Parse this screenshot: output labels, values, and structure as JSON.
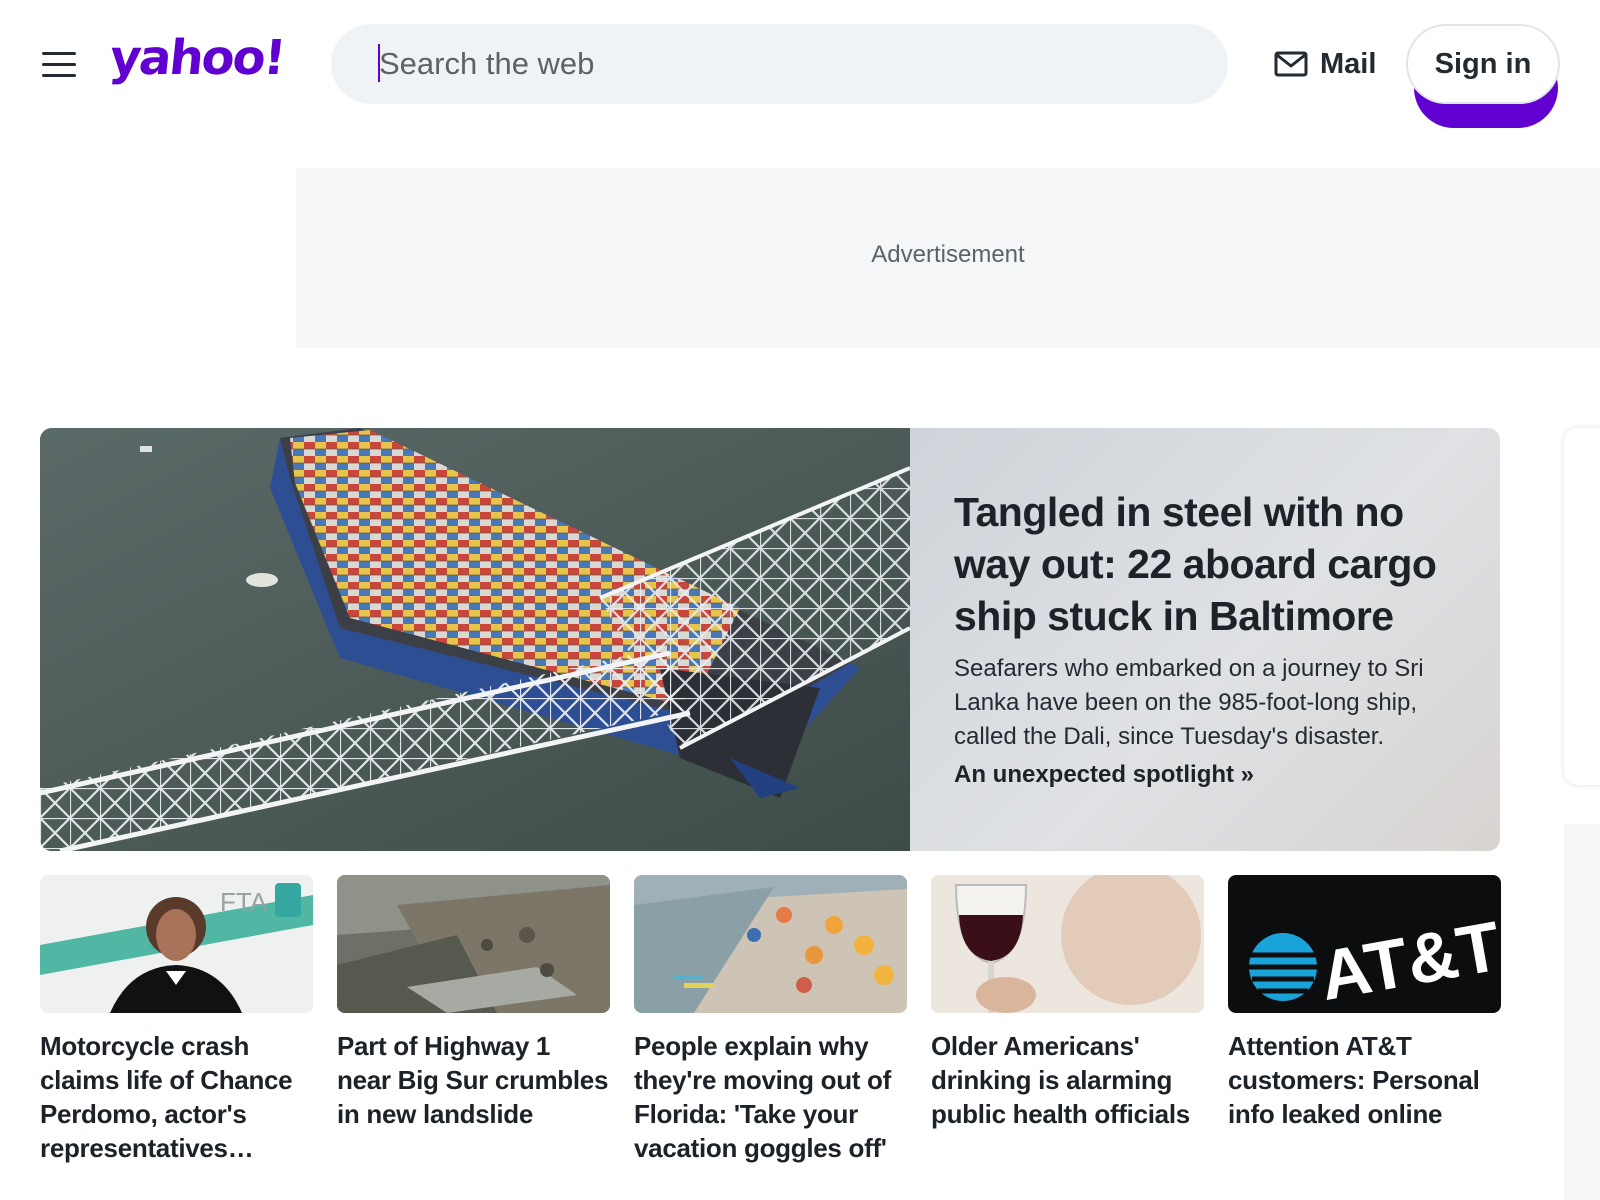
{
  "header": {
    "logo": "yahoo!",
    "search_placeholder": "Search the web",
    "mail_label": "Mail",
    "signin_label": "Sign in",
    "brand_color": "#6001d2"
  },
  "ad": {
    "label": "Advertisement"
  },
  "hero": {
    "title": "Tangled in steel with no way out: 22 aboard cargo ship stuck in Baltimore",
    "summary": "Seafarers who embarked on a journey to Sri Lanka have been on the 985-foot-long ship, called the Dali, since Tuesday's disaster.",
    "link": "An unexpected spotlight »"
  },
  "cards": [
    {
      "title": "Motorcycle crash claims life of Chance Perdomo, actor's representatives…",
      "image_text": "FTA"
    },
    {
      "title": "Part of Highway 1 near Big Sur crumbles in new landslide"
    },
    {
      "title": "People explain why they're moving out of Florida: 'Take your vacation goggles off'"
    },
    {
      "title": "Older Americans' drinking is alarming public health officials"
    },
    {
      "title": "Attention AT&T customers: Personal info leaked online",
      "image_text": "AT&T"
    }
  ]
}
